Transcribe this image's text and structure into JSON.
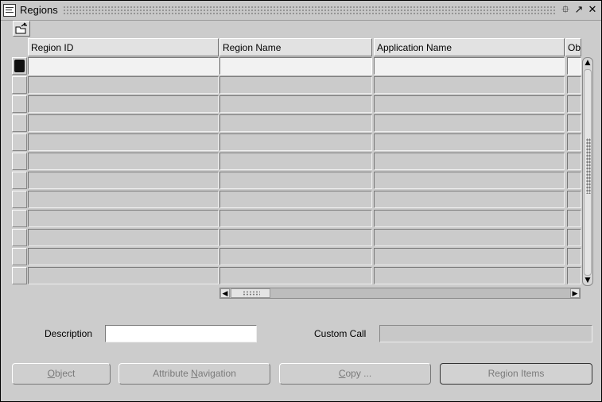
{
  "window": {
    "title": "Regions",
    "controls": [
      "minimize-icon",
      "maximize-icon",
      "close-icon"
    ]
  },
  "toolbar": {
    "icon": "open-folder-icon"
  },
  "grid": {
    "columns": [
      "Region ID",
      "Region Name",
      "Application Name",
      "Ob"
    ],
    "row_count": 12,
    "active_row": 0
  },
  "form": {
    "description_label": "Description",
    "description_value": "",
    "custom_call_label": "Custom Call",
    "custom_call_value": ""
  },
  "buttons": {
    "object": {
      "pre": "",
      "mn": "O",
      "post": "bject"
    },
    "attribute_navigation": {
      "pre": "Attribute ",
      "mn": "N",
      "post": "avigation"
    },
    "copy": {
      "pre": "",
      "mn": "C",
      "post": "opy ..."
    },
    "region_items": {
      "pre": "Region Items",
      "mn": "",
      "post": ""
    }
  },
  "colors": {
    "window_bg": "#cccccc",
    "active_cell": "#f2f2f2",
    "disabled_text": "#7a7a7a"
  }
}
